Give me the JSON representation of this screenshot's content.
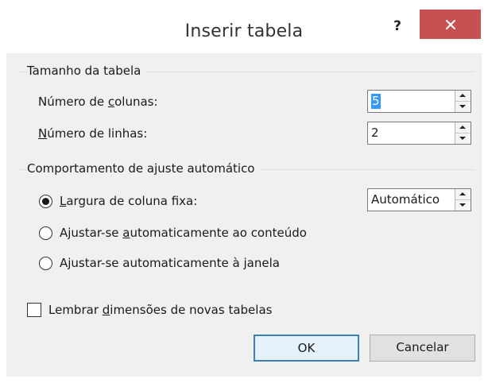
{
  "dialog": {
    "title": "Inserir tabela",
    "help_glyph": "?",
    "close_icon": "close-icon"
  },
  "size_group": {
    "label": "Tamanho da tabela",
    "columns": {
      "label_pre": "Número de ",
      "label_u": "c",
      "label_post": "olunas:",
      "value": "5"
    },
    "rows": {
      "label_u": "N",
      "label_post": "úmero de linhas:",
      "value": "2"
    }
  },
  "autofit_group": {
    "label": "Comportamento de ajuste automático",
    "options": [
      {
        "label_pre": "",
        "label_u": "L",
        "label_post": "argura de coluna fixa:",
        "selected": true
      },
      {
        "label_pre": "Ajustar-se ",
        "label_u": "a",
        "label_post": "utomaticamente ao conteúdo",
        "selected": false
      },
      {
        "label_pre": "Ajustar-se automaticamente à ",
        "label_u": "j",
        "label_post": "anela",
        "selected": false
      }
    ],
    "fixed_width_value": "Automático"
  },
  "remember": {
    "label_pre": "Lembrar ",
    "label_u": "d",
    "label_post": "imensões de novas tabelas",
    "checked": false
  },
  "buttons": {
    "ok": "OK",
    "cancel": "Cancelar"
  },
  "colors": {
    "close_bg": "#c75050",
    "selection": "#3399ff",
    "default_border": "#3c7fb1"
  }
}
